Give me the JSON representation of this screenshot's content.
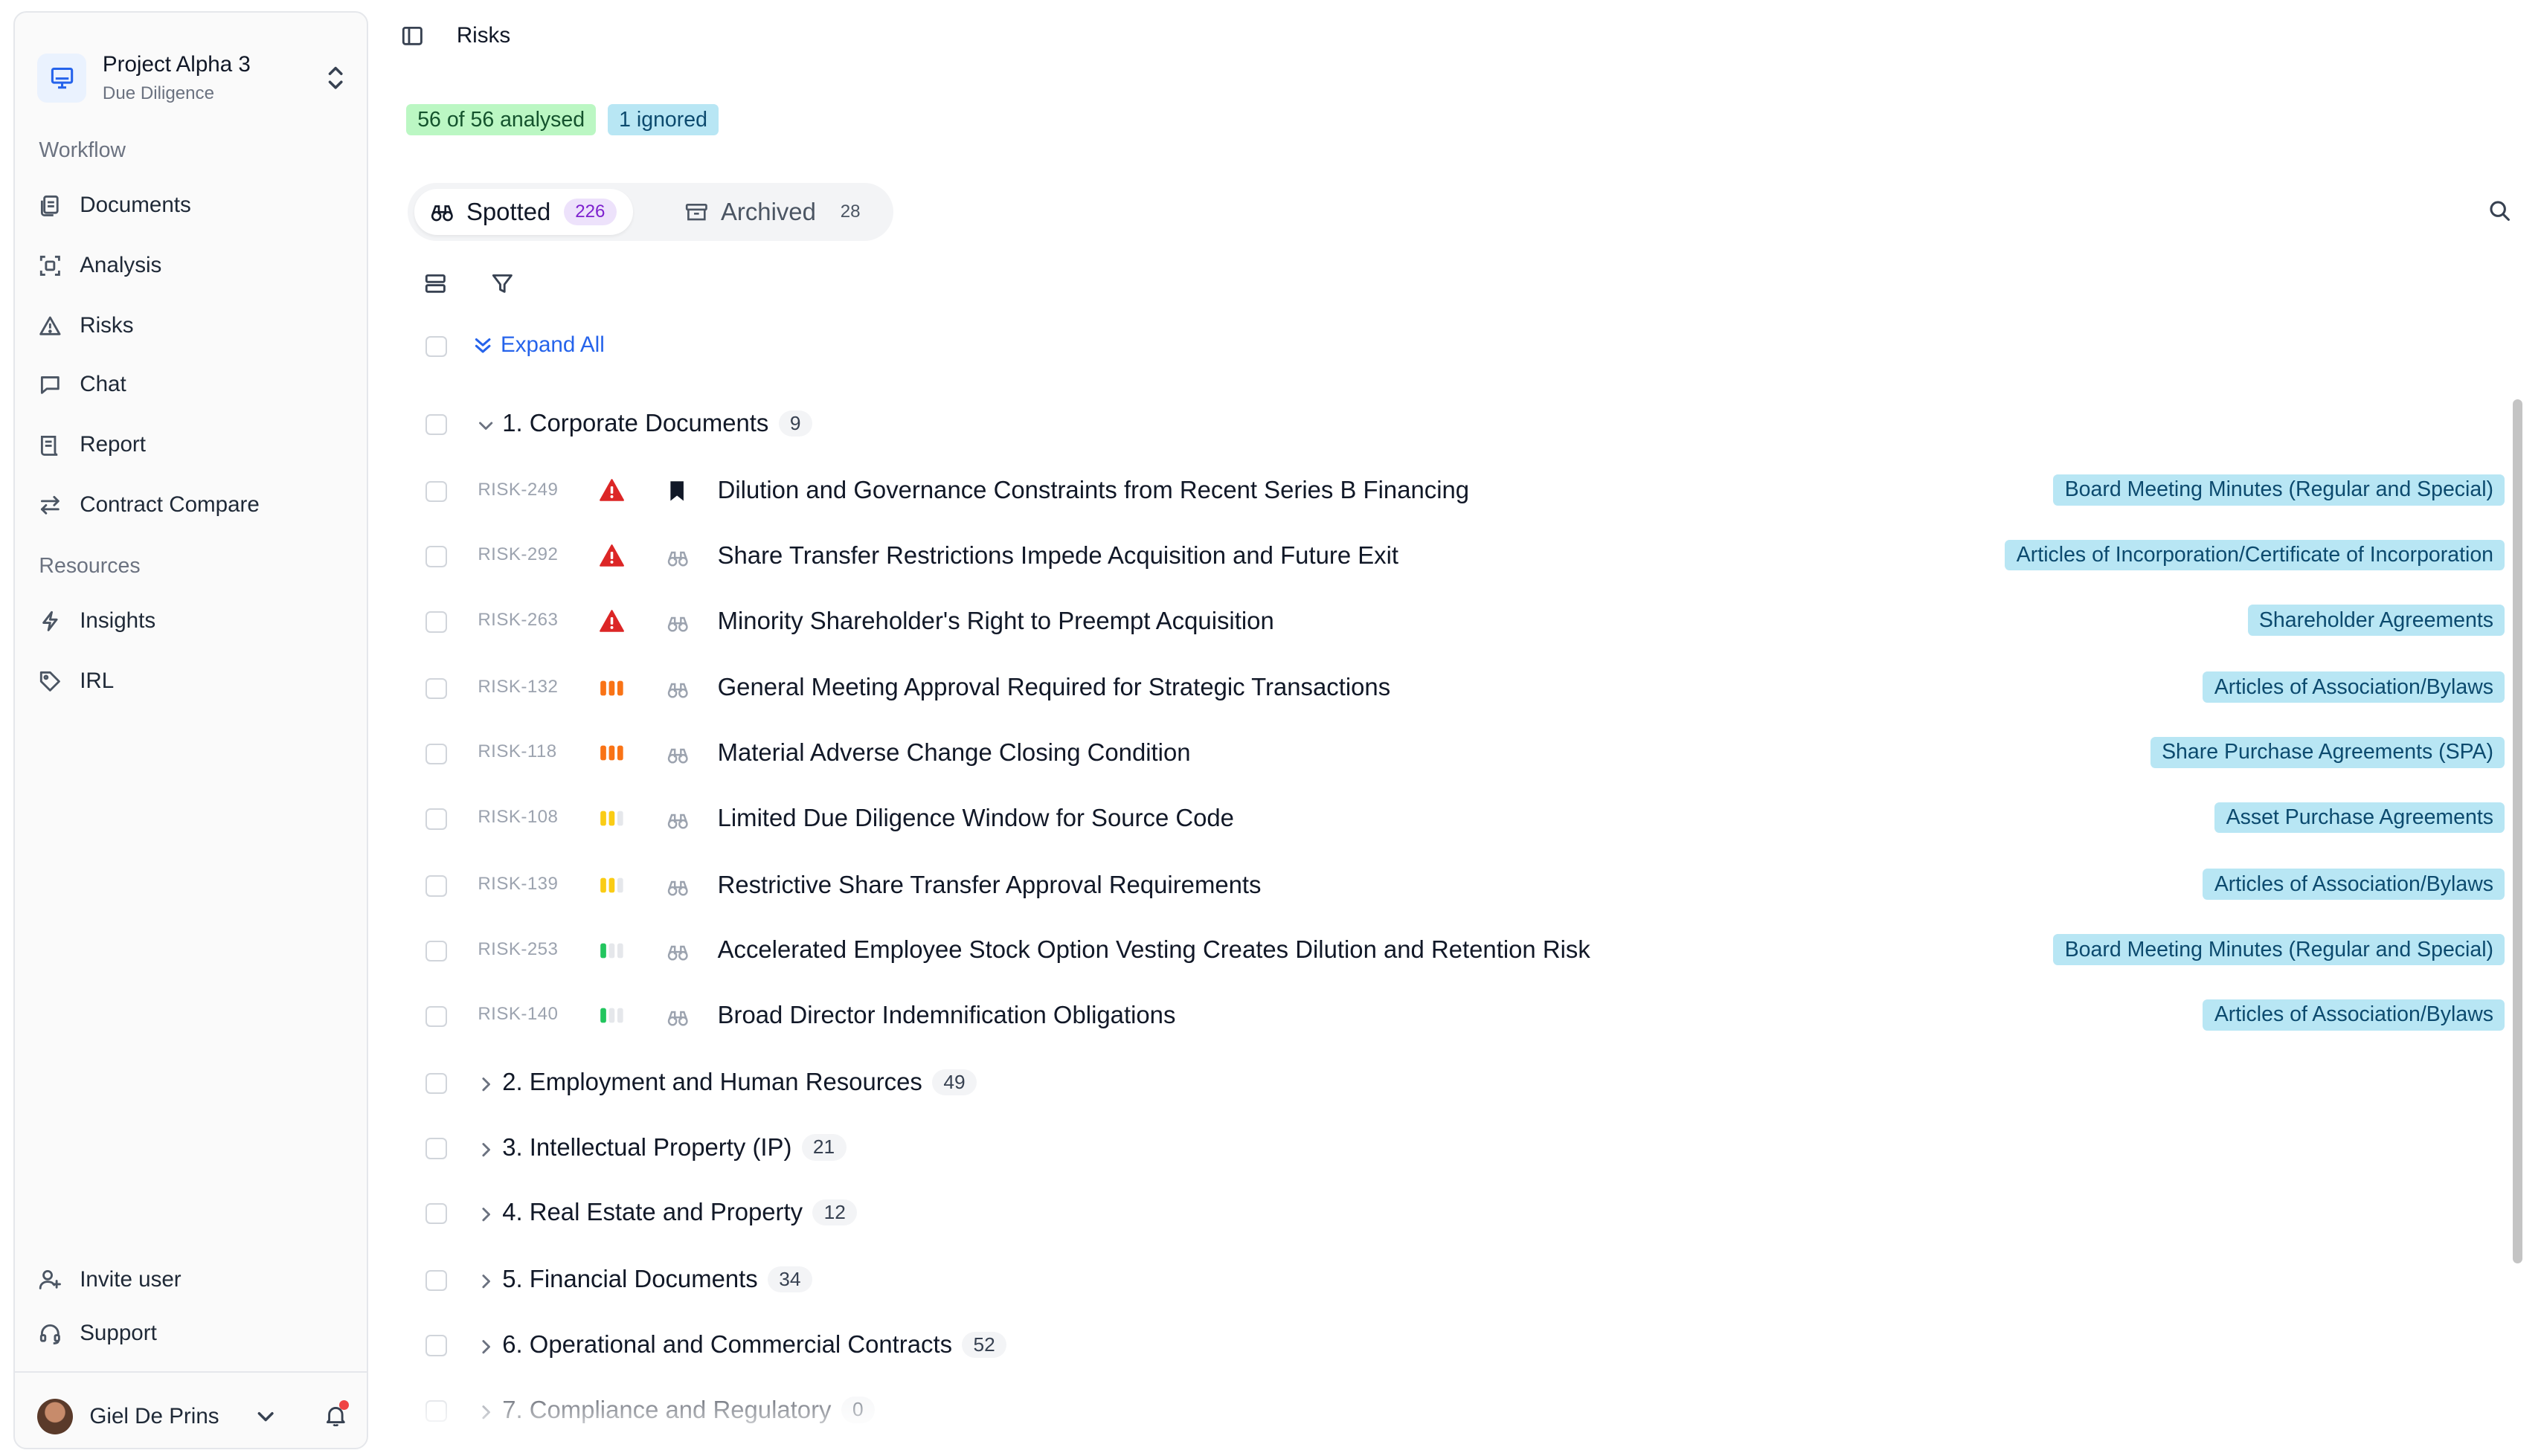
{
  "sidebar": {
    "project_name": "Project Alpha 3",
    "project_sub": "Due Diligence",
    "workflow_title": "Workflow",
    "workflow_items": [
      {
        "label": "Documents",
        "icon": "documents-icon"
      },
      {
        "label": "Analysis",
        "icon": "analysis-icon"
      },
      {
        "label": "Risks",
        "icon": "warning-icon"
      },
      {
        "label": "Chat",
        "icon": "chat-icon"
      },
      {
        "label": "Report",
        "icon": "report-icon"
      },
      {
        "label": "Contract Compare",
        "icon": "compare-icon"
      }
    ],
    "resources_title": "Resources",
    "resource_items": [
      {
        "label": "Insights",
        "icon": "lightning-icon"
      },
      {
        "label": "IRL",
        "icon": "tag-icon"
      }
    ],
    "invite_label": "Invite user",
    "support_label": "Support",
    "user_name": "Giel De Prins"
  },
  "header": {
    "title": "Risks",
    "analysed_badge": "56 of 56 analysed",
    "ignored_badge": "1 ignored"
  },
  "tabs": {
    "spotted_label": "Spotted",
    "spotted_count": "226",
    "archived_label": "Archived",
    "archived_count": "28"
  },
  "toolbar": {
    "expand_all": "Expand All"
  },
  "groups": [
    {
      "title": "1. Corporate Documents",
      "count": "9",
      "expanded": true
    },
    {
      "title": "2. Employment and Human Resources",
      "count": "49"
    },
    {
      "title": "3. Intellectual Property (IP)",
      "count": "21"
    },
    {
      "title": "4. Real Estate and Property",
      "count": "12"
    },
    {
      "title": "5. Financial Documents",
      "count": "34"
    },
    {
      "title": "6. Operational and Commercial Contracts",
      "count": "52"
    },
    {
      "title": "7. Compliance and Regulatory",
      "count": "0"
    }
  ],
  "risks": [
    {
      "id": "RISK-249",
      "severity": "critical",
      "status": "bookmarked",
      "title": "Dilution and Governance Constraints from Recent Series B Financing",
      "tag": "Board Meeting Minutes (Regular and Special)"
    },
    {
      "id": "RISK-292",
      "severity": "critical",
      "status": "spotted",
      "title": "Share Transfer Restrictions Impede Acquisition and Future Exit",
      "tag": "Articles of Incorporation/Certificate of Incorporation"
    },
    {
      "id": "RISK-263",
      "severity": "critical",
      "status": "spotted",
      "title": "Minority Shareholder's Right to Preempt Acquisition",
      "tag": "Shareholder Agreements"
    },
    {
      "id": "RISK-132",
      "severity": "high",
      "status": "spotted",
      "title": "General Meeting Approval Required for Strategic Transactions",
      "tag": "Articles of Association/Bylaws"
    },
    {
      "id": "RISK-118",
      "severity": "high",
      "status": "spotted",
      "title": "Material Adverse Change Closing Condition",
      "tag": "Share Purchase Agreements (SPA)"
    },
    {
      "id": "RISK-108",
      "severity": "medium",
      "status": "spotted",
      "title": "Limited Due Diligence Window for Source Code",
      "tag": "Asset Purchase Agreements"
    },
    {
      "id": "RISK-139",
      "severity": "medium",
      "status": "spotted",
      "title": "Restrictive Share Transfer Approval Requirements",
      "tag": "Articles of Association/Bylaws"
    },
    {
      "id": "RISK-253",
      "severity": "low",
      "status": "spotted",
      "title": "Accelerated Employee Stock Option Vesting Creates Dilution and Retention Risk",
      "tag": "Board Meeting Minutes (Regular and Special)"
    },
    {
      "id": "RISK-140",
      "severity": "low",
      "status": "spotted",
      "title": "Broad Director Indemnification Obligations",
      "tag": "Articles of Association/Bylaws"
    }
  ],
  "colors": {
    "critical": "#dc2626",
    "high": "#f97316",
    "medium": "#facc15",
    "low": "#22c55e",
    "tag_bg": "#b8e6f4",
    "accent": "#2563eb"
  }
}
